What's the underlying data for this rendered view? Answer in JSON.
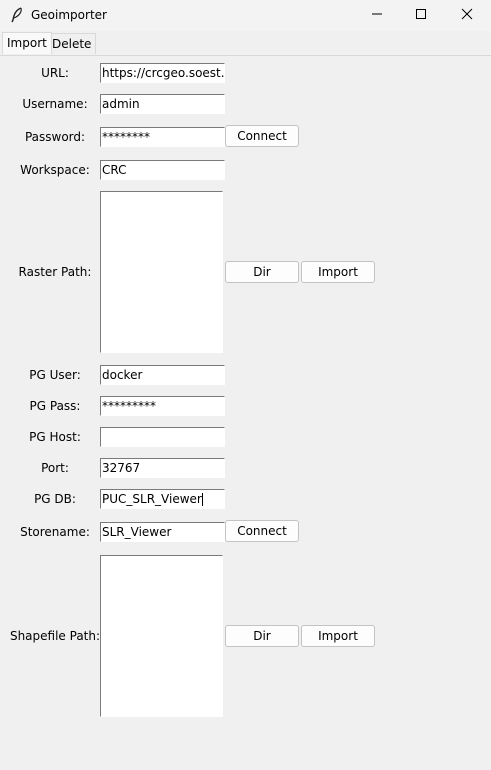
{
  "window": {
    "title": "Geoimporter",
    "app_icon": "feather-icon",
    "controls": [
      "minimize-icon",
      "maximize-icon",
      "close-icon"
    ]
  },
  "tabs": [
    {
      "label": "Import",
      "active": true
    },
    {
      "label": "Delete",
      "active": false
    }
  ],
  "form": {
    "url": {
      "label": "URL:",
      "value": "https://crcgeo.soest.ha"
    },
    "username": {
      "label": "Username:",
      "value": "admin"
    },
    "password": {
      "label": "Password:",
      "value": "********"
    },
    "connect_button": "Connect",
    "workspace": {
      "label": "Workspace:",
      "value": "CRC"
    },
    "raster_path": {
      "label": "Raster Path:"
    },
    "raster_dir_button": "Dir",
    "raster_import_button": "Import",
    "pg_user": {
      "label": "PG User:",
      "value": "docker"
    },
    "pg_pass": {
      "label": "PG Pass:",
      "value": "*********"
    },
    "pg_host": {
      "label": "PG Host:",
      "value": ""
    },
    "port": {
      "label": "Port:",
      "value": "32767"
    },
    "pg_db": {
      "label": "PG DB:",
      "value": "PUC_SLR_Viewer"
    },
    "storename": {
      "label": "Storename:",
      "value": "SLR_Viewer"
    },
    "store_connect_button": "Connect",
    "shapefile_path": {
      "label": "Shapefile Path:"
    },
    "shapefile_dir_button": "Dir",
    "shapefile_import_button": "Import"
  }
}
